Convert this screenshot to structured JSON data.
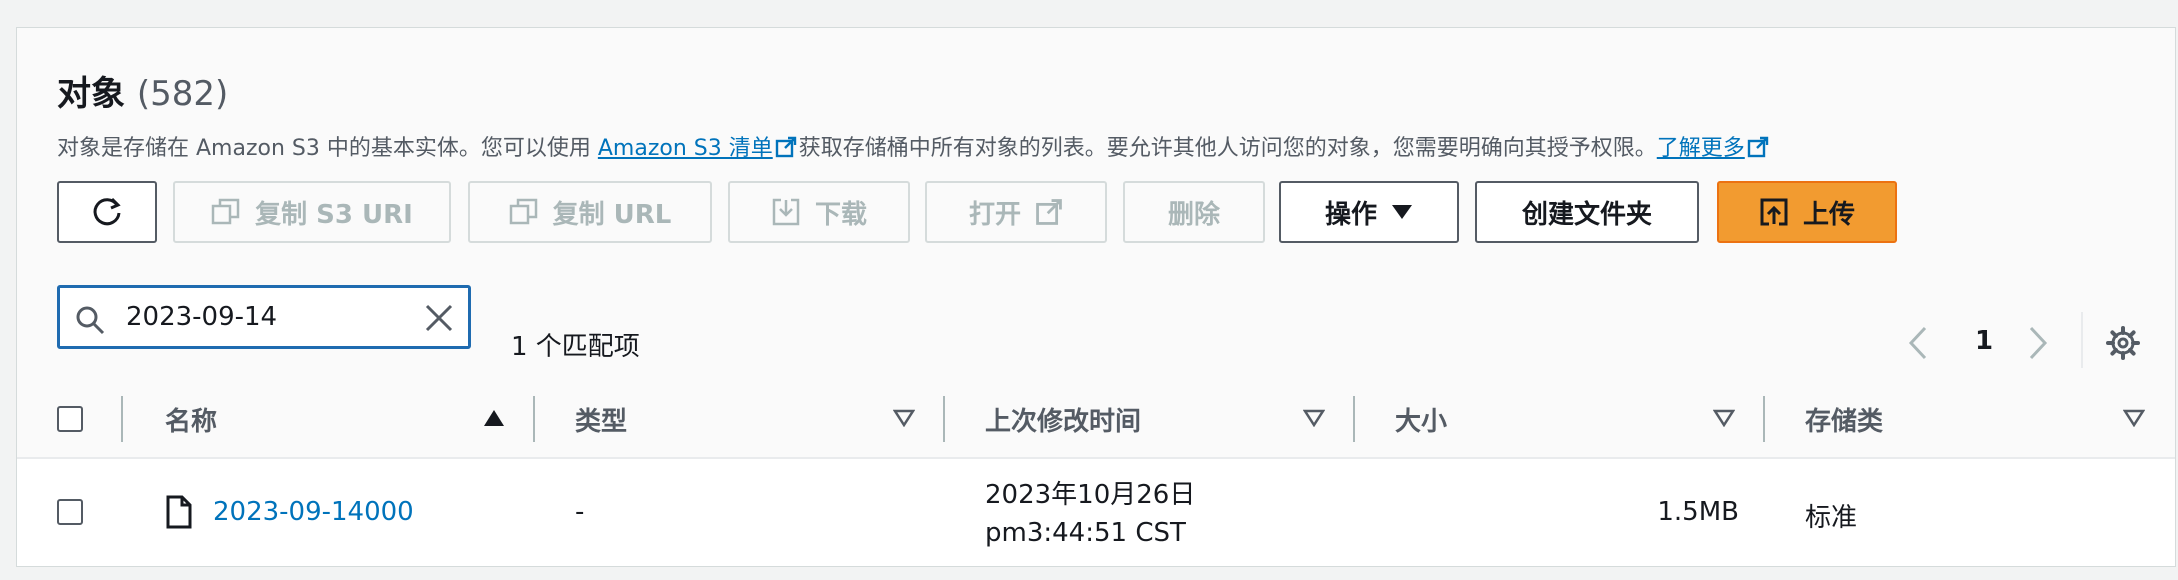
{
  "header": {
    "title": "对象",
    "count": "(582)",
    "desc_part1": "对象是存储在 Amazon S3 中的基本实体。您可以使用 ",
    "desc_link": "Amazon S3 清单",
    "desc_part2": "获取存储桶中所有对象的列表。要允许其他人访问您的对象，您需要明确向其授予权限。",
    "learn_more": "了解更多"
  },
  "toolbar": {
    "copy_s3_uri": "复制 S3 URI",
    "copy_url": "复制 URL",
    "download": "下载",
    "open": "打开",
    "delete": "删除",
    "actions": "操作",
    "create_folder": "创建文件夹",
    "upload": "上传"
  },
  "search": {
    "value": "2023-09-14",
    "matches": "1 个匹配项"
  },
  "pagination": {
    "current_page": "1"
  },
  "table": {
    "columns": [
      "名称",
      "类型",
      "上次修改时间",
      "大小",
      "存储类"
    ],
    "rows": [
      {
        "name": "2023-09-14000",
        "type": "-",
        "modified_date": "2023年10月26日",
        "modified_time": "pm3:44:51 CST",
        "size": "1.5MB",
        "storage_class": "标准"
      }
    ]
  },
  "colors": {
    "link": "#0073bb",
    "primary": "#f29b30",
    "disabled_text": "#aab7b8",
    "focus": "#1f6bb0"
  },
  "icons": [
    "refresh-icon",
    "copy-icon",
    "download-icon",
    "external-link-icon",
    "caret-down-icon",
    "upload-icon",
    "search-icon",
    "clear-icon",
    "chevron-left-icon",
    "chevron-right-icon",
    "gear-icon",
    "sort-ascending-icon",
    "sort-descending-icon",
    "file-icon"
  ]
}
